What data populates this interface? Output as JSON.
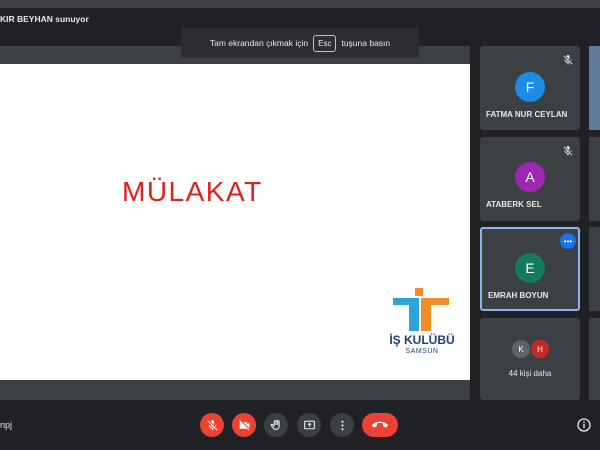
{
  "presenter_banner": "KIR BEYHAN sunuyor",
  "fullscreen_hint": {
    "before": "Tam ekrandan çıkmak için",
    "key": "Esc",
    "after": "tuşuna basın"
  },
  "slide": {
    "title": "MÜLAKAT",
    "logo_text": "İŞ KULÜBÜ",
    "logo_sub": "SAMSUN"
  },
  "participants": [
    {
      "initial": "F",
      "name": "FATMA NUR CEYLAN",
      "color": "#1a8ce8",
      "muted": true
    },
    {
      "initial": "A",
      "name": "ATABERK SEL",
      "color": "#9c27b0",
      "muted": true
    },
    {
      "initial": "E",
      "name": "EMRAH BOYUN",
      "color": "#137a5e",
      "active": true
    }
  ],
  "more_tile": {
    "initials": [
      "K",
      "H"
    ],
    "colors": [
      "#5f6368",
      "#c62828"
    ],
    "label": "44 kişi daha"
  },
  "meeting_code": "npj",
  "controls": [
    "mic-off",
    "camera-off",
    "raise-hand",
    "present",
    "more-options",
    "leave-call"
  ],
  "icons": [
    "mic-off-icon",
    "camera-off-icon",
    "hand-icon",
    "present-icon",
    "more-vert-icon",
    "phone-hangup-icon",
    "info-icon"
  ]
}
